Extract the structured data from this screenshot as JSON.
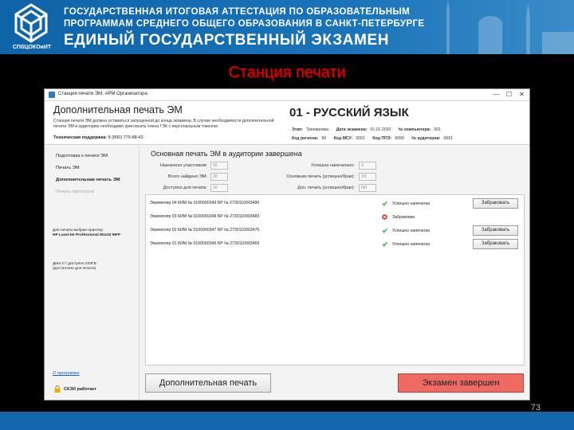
{
  "header": {
    "line1": "ГОСУДАРСТВЕННАЯ ИТОГОВАЯ АТТЕСТАЦИЯ ПО ОБРАЗОВАТЕЛЬНЫМ",
    "line2": "ПРОГРАММАМ СРЕДНЕГО ОБЩЕГО ОБРАЗОВАНИЯ В САНКТ-ПЕТЕРБУРГЕ",
    "line3": "ЕДИНЫЙ ГОСУДАРСТВЕННЫЙ ЭКЗАМЕН",
    "logo_caption": "СПбЦОКОиИТ"
  },
  "slide_title": "Станция печати",
  "window": {
    "title": "Станция печати ЭМ. АРМ Организатора",
    "controls": {
      "minimize": "—",
      "maximize": "☐",
      "close": "✕"
    }
  },
  "top_panel": {
    "title": "Дополнительная печать ЭМ",
    "description": "Станция печати ЭМ должна оставаться запущенной до конца экзамена. В случае необходимости дополнительной печати ЭМ в аудиторию необходимо пригласить члена ГЭК с персональным токеном.",
    "support_label": "Техническая поддержка:",
    "support_phone": "8 (800) 775-88-43",
    "subject": "01 - РУССКИЙ ЯЗЫК",
    "meta_row1": [
      {
        "label": "Этап:",
        "value": "Тренировка"
      },
      {
        "label": "Дата экзамена:",
        "value": "01.01.2020"
      },
      {
        "label": "№ компьютера:",
        "value": "001"
      }
    ],
    "meta_row2": [
      {
        "label": "Код региона:",
        "value": "90"
      },
      {
        "label": "Код МСУ:",
        "value": "0001"
      },
      {
        "label": "Код ППЭ:",
        "value": "9099"
      },
      {
        "label": "№ аудитории:",
        "value": "0001"
      }
    ]
  },
  "nav": {
    "items": [
      {
        "label": "Подготовка к печати ЭМ",
        "state": "normal"
      },
      {
        "label": "Печать ЭМ",
        "state": "normal"
      },
      {
        "label": "Дополнительная печать ЭМ",
        "state": "active"
      },
      {
        "label": "Печать протокола",
        "state": "disabled"
      }
    ],
    "printer_label": "Для печати выбран принтер:",
    "printer_name": "HP LaserJet Professional M1132 MFP",
    "disk_line1": "Диск C:\\ доступно 233ГБ",
    "disk_line2": "(достаточно для печати)",
    "about_link": "О программе",
    "skzi_label": "СКЗИ работает"
  },
  "main": {
    "section_title": "Основная печать ЭМ в аудитории завершена",
    "stats_left": [
      {
        "label": "Назначено участников:",
        "value": "15"
      },
      {
        "label": "Всего найдено ЭМ:",
        "value": "20"
      },
      {
        "label": "Доступно для печати:",
        "value": "16"
      }
    ],
    "stats_right": [
      {
        "label": "Успешно напечатано:",
        "value": "3"
      },
      {
        "label": "Основная печать (успешно/брак):",
        "value": "3/1"
      },
      {
        "label": "Доп. печать (успешно/брак):",
        "value": "0/0"
      }
    ],
    "rows": [
      {
        "text": "Экземпляр 04  КИМ № 0100000349  БР № 2730110003490",
        "status": "Успешно напечатан",
        "status_type": "ok",
        "button": "Забраковать"
      },
      {
        "text": "Экземпляр 03  КИМ № 0100000348  БР № 2730110003483",
        "status": "Забракован",
        "status_type": "rejected",
        "button": ""
      },
      {
        "text": "Экземпляр 02  КИМ № 0100000347  БР № 2730110003476",
        "status": "Успешно напечатан",
        "status_type": "ok",
        "button": "Забраковать"
      },
      {
        "text": "Экземпляр 01  КИМ № 0100000346  БР № 2730110003469",
        "status": "Успешно напечатан",
        "status_type": "ok",
        "button": "Забраковать"
      }
    ],
    "btn_extra_print": "Дополнительная печать",
    "btn_finish": "Экзамен завершен"
  },
  "colors": {
    "header_blue": "#1467ac",
    "title_red": "#e00000",
    "ok_green": "#3aa13a",
    "reject_red": "#d9342b",
    "finish_button": "#f06a64"
  },
  "page_number": "73"
}
